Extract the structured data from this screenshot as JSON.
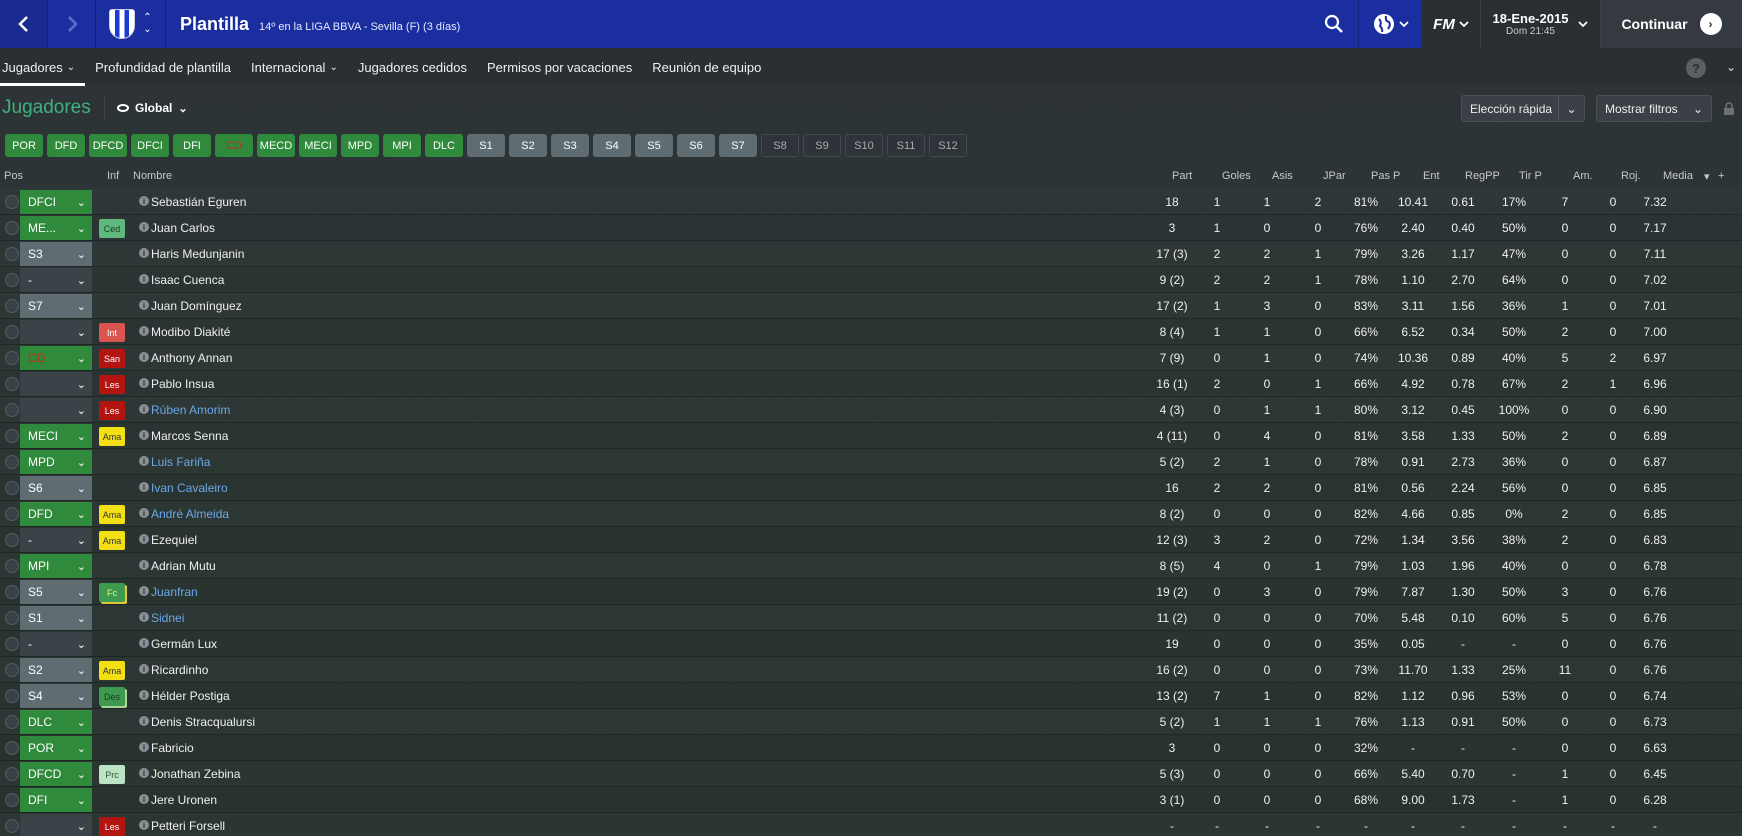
{
  "header": {
    "title": "Plantilla",
    "subtitle": "14º en la LIGA BBVA - Sevilla (F) (3 días)",
    "fm_label": "FM",
    "date": "18-Ene-2015",
    "time": "Dom 21:45",
    "continue_label": "Continuar"
  },
  "tabs": [
    {
      "label": "Jugadores",
      "dropdown": true,
      "active": true
    },
    {
      "label": "Profundidad de plantilla"
    },
    {
      "label": "Internacional",
      "dropdown": true
    },
    {
      "label": "Jugadores cedidos"
    },
    {
      "label": "Permisos por vacaciones"
    },
    {
      "label": "Reunión de equipo"
    }
  ],
  "section": {
    "title": "Jugadores",
    "view": "Global",
    "quick_pick": "Elección rápida",
    "filters": "Mostrar filtros"
  },
  "chips": [
    {
      "label": "POR",
      "style": "g"
    },
    {
      "label": "DFD",
      "style": "g"
    },
    {
      "label": "DFCD",
      "style": "g"
    },
    {
      "label": "DFCI",
      "style": "g"
    },
    {
      "label": "DFI",
      "style": "g"
    },
    {
      "label": "CD",
      "style": "gd"
    },
    {
      "label": "MECD",
      "style": "g"
    },
    {
      "label": "MECI",
      "style": "g"
    },
    {
      "label": "MPD",
      "style": "g"
    },
    {
      "label": "MPI",
      "style": "g"
    },
    {
      "label": "DLC",
      "style": "g"
    },
    {
      "label": "S1",
      "style": "s"
    },
    {
      "label": "S2",
      "style": "s"
    },
    {
      "label": "S3",
      "style": "s"
    },
    {
      "label": "S4",
      "style": "s"
    },
    {
      "label": "S5",
      "style": "s"
    },
    {
      "label": "S6",
      "style": "s"
    },
    {
      "label": "S7",
      "style": "s"
    },
    {
      "label": "S8",
      "style": "e"
    },
    {
      "label": "S9",
      "style": "e"
    },
    {
      "label": "S10",
      "style": "e"
    },
    {
      "label": "S11",
      "style": "e"
    },
    {
      "label": "S12",
      "style": "e"
    }
  ],
  "columns": {
    "pos": "Pos",
    "inf": "Inf",
    "name": "Nombre",
    "part": "Part",
    "goles": "Goles",
    "asis": "Asis",
    "jpar": "JPar",
    "pasp": "Pas P",
    "ent": "Ent",
    "regpp": "RegPP",
    "tirp": "Tir P",
    "am": "Am.",
    "roj": "Roj.",
    "media": "Media"
  },
  "players": [
    {
      "pos": "DFCI",
      "pos_style": "g",
      "badge": "",
      "name": "Sebastián Eguren",
      "blue": false,
      "stats": [
        "18",
        "1",
        "1",
        "2",
        "81%",
        "10.41",
        "0.61",
        "17%",
        "7",
        "0",
        "7.32"
      ]
    },
    {
      "pos": "ME...",
      "pos_style": "g",
      "badge": "Ced",
      "name": "Juan Carlos",
      "blue": false,
      "stats": [
        "3",
        "1",
        "0",
        "0",
        "76%",
        "2.40",
        "0.40",
        "50%",
        "0",
        "0",
        "7.17"
      ]
    },
    {
      "pos": "S3",
      "pos_style": "s",
      "badge": "",
      "name": "Haris Medunjanin",
      "blue": false,
      "stats": [
        "17 (3)",
        "2",
        "2",
        "1",
        "79%",
        "3.26",
        "1.17",
        "47%",
        "0",
        "0",
        "7.11"
      ]
    },
    {
      "pos": "-",
      "pos_style": "n",
      "badge": "",
      "name": "Isaac Cuenca",
      "blue": false,
      "stats": [
        "9 (2)",
        "2",
        "2",
        "1",
        "78%",
        "1.10",
        "2.70",
        "64%",
        "0",
        "0",
        "7.02"
      ]
    },
    {
      "pos": "S7",
      "pos_style": "s",
      "badge": "",
      "name": "Juan Domínguez",
      "blue": false,
      "stats": [
        "17 (2)",
        "1",
        "3",
        "0",
        "83%",
        "3.11",
        "1.56",
        "36%",
        "1",
        "0",
        "7.01"
      ]
    },
    {
      "pos": "",
      "pos_style": "n",
      "badge": "Int",
      "name": "Modibo Diakité",
      "blue": false,
      "stats": [
        "8 (4)",
        "1",
        "1",
        "0",
        "66%",
        "6.52",
        "0.34",
        "50%",
        "2",
        "0",
        "7.00"
      ]
    },
    {
      "pos": "CD",
      "pos_style": "g",
      "pos_red": true,
      "badge": "San",
      "name": "Anthony Annan",
      "blue": false,
      "stats": [
        "7 (9)",
        "0",
        "1",
        "0",
        "74%",
        "10.36",
        "0.89",
        "40%",
        "5",
        "2",
        "6.97"
      ]
    },
    {
      "pos": "",
      "pos_style": "n",
      "badge": "Les",
      "name": "Pablo Insua",
      "blue": false,
      "stats": [
        "16 (1)",
        "2",
        "0",
        "1",
        "66%",
        "4.92",
        "0.78",
        "67%",
        "2",
        "1",
        "6.96"
      ]
    },
    {
      "pos": "",
      "pos_style": "n",
      "badge": "Les",
      "name": "Rúben Amorim",
      "blue": true,
      "stats": [
        "4 (3)",
        "0",
        "1",
        "1",
        "80%",
        "3.12",
        "0.45",
        "100%",
        "0",
        "0",
        "6.90"
      ]
    },
    {
      "pos": "MECI",
      "pos_style": "g",
      "badge": "Ama",
      "name": "Marcos Senna",
      "blue": false,
      "stats": [
        "4 (11)",
        "0",
        "4",
        "0",
        "81%",
        "3.58",
        "1.33",
        "50%",
        "2",
        "0",
        "6.89"
      ]
    },
    {
      "pos": "MPD",
      "pos_style": "g",
      "badge": "",
      "name": "Luis Fariña",
      "blue": true,
      "stats": [
        "5 (2)",
        "2",
        "1",
        "0",
        "78%",
        "0.91",
        "2.73",
        "36%",
        "0",
        "0",
        "6.87"
      ]
    },
    {
      "pos": "S6",
      "pos_style": "s",
      "badge": "",
      "name": "Ivan Cavaleiro",
      "blue": true,
      "stats": [
        "16",
        "2",
        "2",
        "0",
        "81%",
        "0.56",
        "2.24",
        "56%",
        "0",
        "0",
        "6.85"
      ]
    },
    {
      "pos": "DFD",
      "pos_style": "g",
      "badge": "Ama",
      "name": "André Almeida",
      "blue": true,
      "stats": [
        "8 (2)",
        "0",
        "0",
        "0",
        "82%",
        "4.66",
        "0.85",
        "0%",
        "2",
        "0",
        "6.85"
      ]
    },
    {
      "pos": "-",
      "pos_style": "n",
      "badge": "Ama",
      "name": "Ezequiel",
      "blue": false,
      "stats": [
        "12 (3)",
        "3",
        "2",
        "0",
        "72%",
        "1.34",
        "3.56",
        "38%",
        "2",
        "0",
        "6.83"
      ]
    },
    {
      "pos": "MPI",
      "pos_style": "g",
      "badge": "",
      "name": "Adrian Mutu",
      "blue": false,
      "stats": [
        "8 (5)",
        "4",
        "0",
        "1",
        "79%",
        "1.03",
        "1.96",
        "40%",
        "0",
        "0",
        "6.78"
      ]
    },
    {
      "pos": "S5",
      "pos_style": "s",
      "badge": "Fc",
      "name": "Juanfran",
      "blue": true,
      "stats": [
        "19 (2)",
        "0",
        "3",
        "0",
        "79%",
        "7.87",
        "1.30",
        "50%",
        "3",
        "0",
        "6.76"
      ]
    },
    {
      "pos": "S1",
      "pos_style": "s",
      "badge": "",
      "name": "Sidnei",
      "blue": true,
      "stats": [
        "11 (2)",
        "0",
        "0",
        "0",
        "70%",
        "5.48",
        "0.10",
        "60%",
        "5",
        "0",
        "6.76"
      ]
    },
    {
      "pos": "-",
      "pos_style": "n",
      "badge": "",
      "name": "Germán Lux",
      "blue": false,
      "stats": [
        "19",
        "0",
        "0",
        "0",
        "35%",
        "0.05",
        "-",
        "-",
        "0",
        "0",
        "6.76"
      ]
    },
    {
      "pos": "S2",
      "pos_style": "s",
      "badge": "Ama",
      "name": "Ricardinho",
      "blue": false,
      "stats": [
        "16 (2)",
        "0",
        "0",
        "0",
        "73%",
        "11.70",
        "1.33",
        "25%",
        "11",
        "0",
        "6.76"
      ]
    },
    {
      "pos": "S4",
      "pos_style": "s",
      "badge": "Des",
      "name": "Hélder Postiga",
      "blue": false,
      "stats": [
        "13 (2)",
        "7",
        "1",
        "0",
        "82%",
        "1.12",
        "0.96",
        "53%",
        "0",
        "0",
        "6.74"
      ]
    },
    {
      "pos": "DLC",
      "pos_style": "g",
      "badge": "",
      "name": "Denis Stracqualursi",
      "blue": false,
      "stats": [
        "5 (2)",
        "1",
        "1",
        "1",
        "76%",
        "1.13",
        "0.91",
        "50%",
        "0",
        "0",
        "6.73"
      ]
    },
    {
      "pos": "POR",
      "pos_style": "g",
      "badge": "",
      "name": "Fabricio",
      "blue": false,
      "stats": [
        "3",
        "0",
        "0",
        "0",
        "32%",
        "-",
        "-",
        "-",
        "0",
        "0",
        "6.63"
      ]
    },
    {
      "pos": "DFCD",
      "pos_style": "g",
      "badge": "Prc",
      "name": "Jonathan Zebina",
      "blue": false,
      "stats": [
        "5 (3)",
        "0",
        "0",
        "0",
        "66%",
        "5.40",
        "0.70",
        "-",
        "1",
        "0",
        "6.45"
      ]
    },
    {
      "pos": "DFI",
      "pos_style": "g",
      "badge": "",
      "name": "Jere Uronen",
      "blue": false,
      "stats": [
        "3 (1)",
        "0",
        "0",
        "0",
        "68%",
        "9.00",
        "1.73",
        "-",
        "1",
        "0",
        "6.28"
      ]
    },
    {
      "pos": "",
      "pos_style": "n",
      "badge": "Les",
      "name": "Petteri Forsell",
      "blue": false,
      "stats": [
        "-",
        "-",
        "-",
        "-",
        "-",
        "-",
        "-",
        "-",
        "-",
        "-",
        "-"
      ]
    }
  ]
}
